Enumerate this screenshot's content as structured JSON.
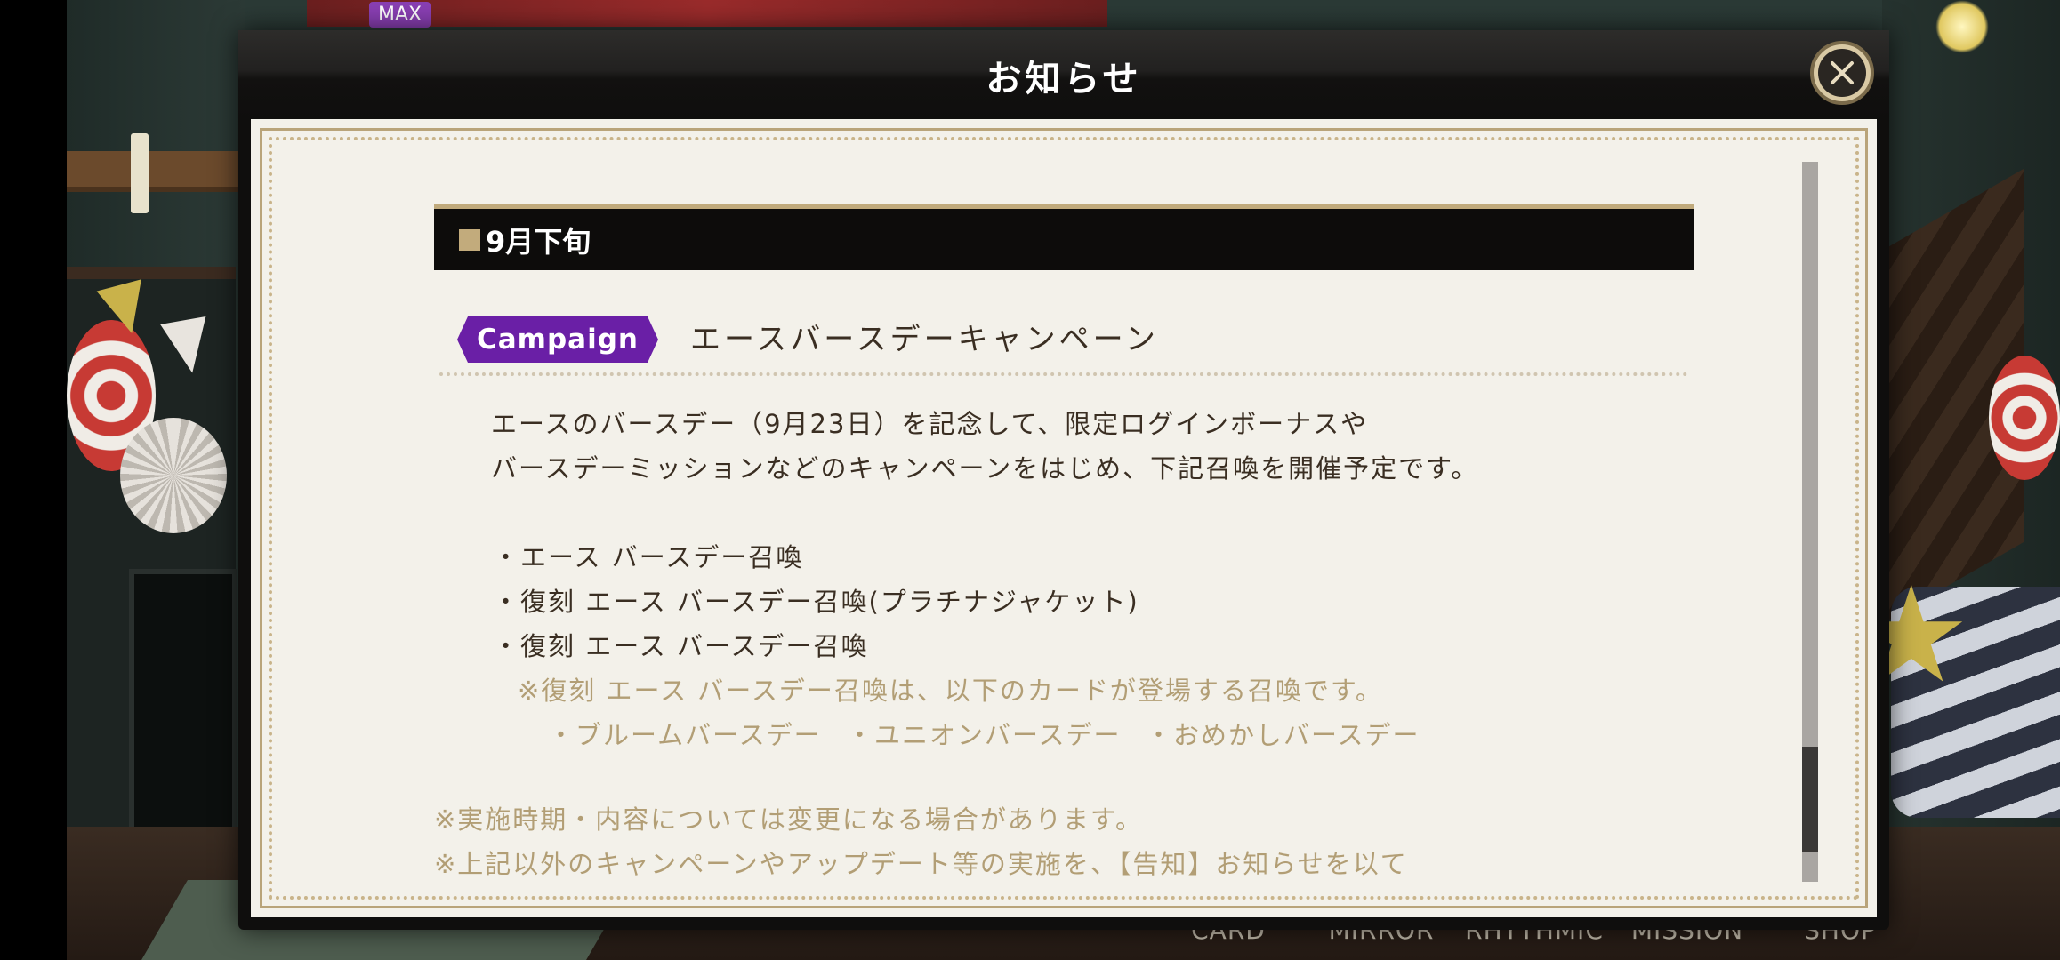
{
  "background": {
    "badge": "MAX",
    "bottom_nav": [
      "CARD",
      "MIRROR",
      "RHYTHMIC",
      "MISSION",
      "SHOP"
    ]
  },
  "modal": {
    "title": "お知らせ",
    "close_icon": "close-icon"
  },
  "notice": {
    "section_heading": "9月下旬",
    "tag": "Campaign",
    "campaign_title": "エースバースデーキャンペーン",
    "body": [
      "エースのバースデー（9月23日）を記念して、限定ログインボーナスや",
      "バースデーミッションなどのキャンペーンをはじめ、下記召喚を開催予定です。"
    ],
    "bullets": [
      "・エース バースデー召喚",
      "・復刻 エース バースデー召喚(プラチナジャケット)",
      "・復刻 エース バースデー召喚"
    ],
    "sub_note": "※復刻 エース バースデー召喚は、以下のカードが登場する召喚です。",
    "sub_items": [
      "・ブルームバースデー",
      "・ユニオンバースデー",
      "・おめかしバースデー"
    ],
    "footer_notes": [
      "※実施時期・内容については変更になる場合があります。",
      "※上記以外のキャンペーンやアップデート等の実施を、【告知】お知らせを以て"
    ]
  },
  "colors": {
    "tag_purple": "#6a1fa6",
    "gold": "#c2ab7c",
    "note_text": "#b29e75",
    "paper": "#f3f1ea"
  }
}
